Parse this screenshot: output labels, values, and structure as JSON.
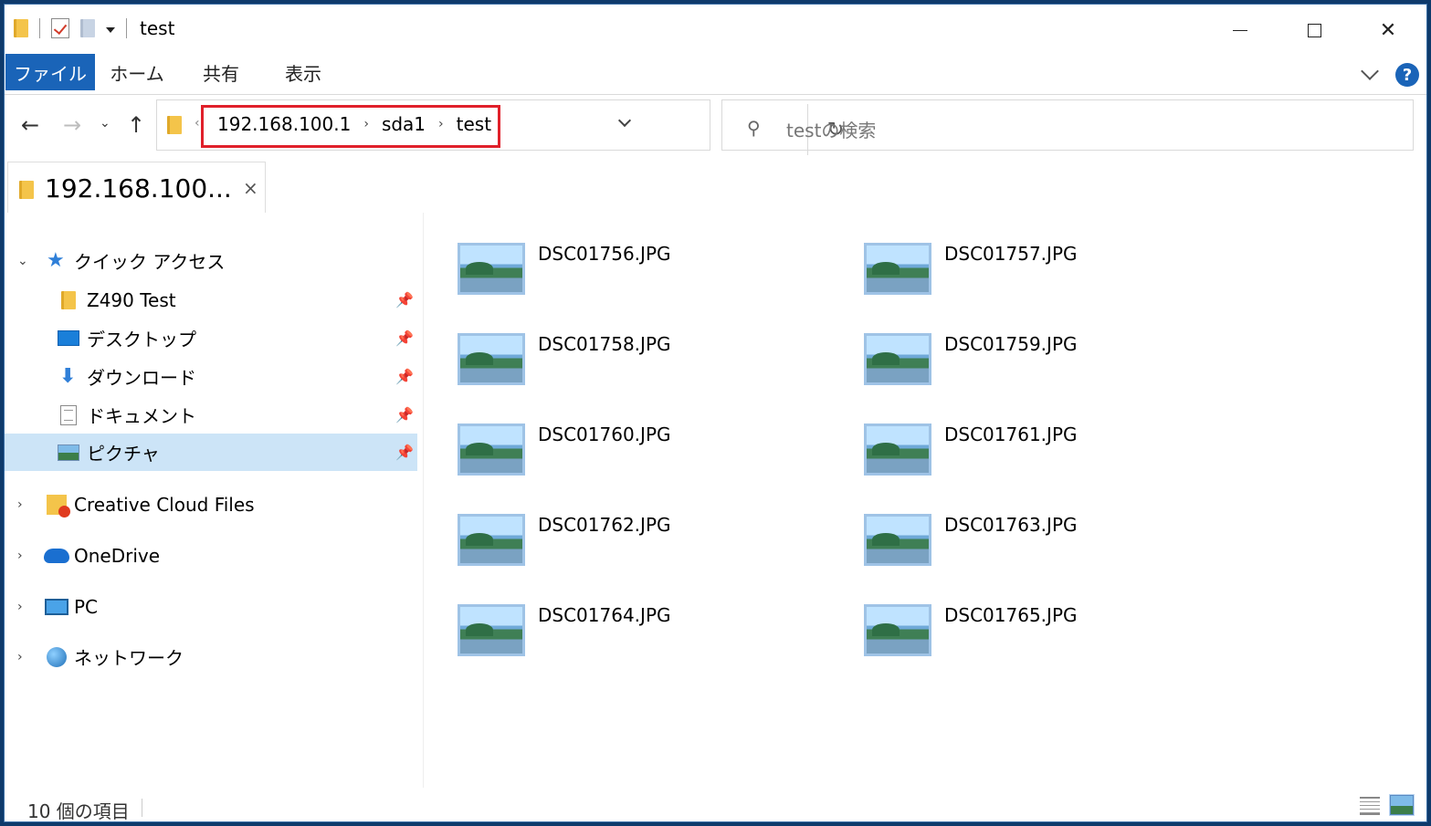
{
  "window": {
    "title": "test",
    "controls": {
      "minimize": "minimize",
      "maximize": "maximize",
      "close": "✕"
    }
  },
  "ribbon": {
    "tabs": [
      {
        "label": "ファイル",
        "active": true
      },
      {
        "label": "ホーム"
      },
      {
        "label": "共有"
      },
      {
        "label": "表示"
      }
    ],
    "help": "?"
  },
  "nav": {
    "back": "←",
    "forward": "→",
    "recent": "⌄",
    "up": "↑",
    "refresh": "↻",
    "breadcrumbs": [
      "192.168.100.1",
      "sda1",
      "test"
    ],
    "crumb_separator": "›",
    "search_placeholder": "testの検索"
  },
  "doc_tab": {
    "label": "192.168.100...",
    "close": "×"
  },
  "sidebar": {
    "quick_access": {
      "label": "クイック アクセス",
      "expanded": true
    },
    "pinned": [
      {
        "label": "Z490 Test",
        "icon": "folder-icon"
      },
      {
        "label": "デスクトップ",
        "icon": "desktop-icon"
      },
      {
        "label": "ダウンロード",
        "icon": "download-icon"
      },
      {
        "label": "ドキュメント",
        "icon": "documents-icon"
      },
      {
        "label": "ピクチャ",
        "icon": "pictures-icon",
        "selected": true
      }
    ],
    "roots": [
      {
        "label": "Creative Cloud Files",
        "icon": "creative-cloud-icon"
      },
      {
        "label": "OneDrive",
        "icon": "onedrive-icon"
      },
      {
        "label": "PC",
        "icon": "pc-icon"
      },
      {
        "label": "ネットワーク",
        "icon": "network-icon"
      }
    ]
  },
  "files": [
    "DSC01756.JPG",
    "DSC01757.JPG",
    "DSC01758.JPG",
    "DSC01759.JPG",
    "DSC01760.JPG",
    "DSC01761.JPG",
    "DSC01762.JPG",
    "DSC01763.JPG",
    "DSC01764.JPG",
    "DSC01765.JPG"
  ],
  "status": {
    "item_count": "10 個の項目"
  },
  "colors": {
    "accent": "#1a64b8",
    "selection": "#cce4f7",
    "highlight_box": "#e0202a"
  }
}
